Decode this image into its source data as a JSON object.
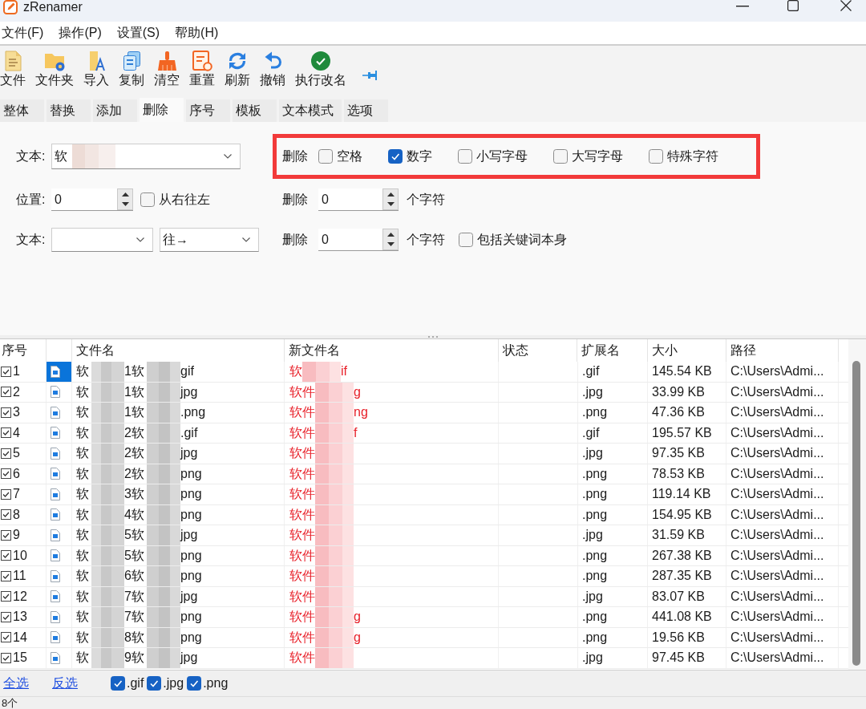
{
  "window": {
    "title": "zRenamer"
  },
  "menu": [
    {
      "label": "文件(F)"
    },
    {
      "label": "操作(P)"
    },
    {
      "label": "设置(S)"
    },
    {
      "label": "帮助(H)"
    }
  ],
  "toolbar": [
    {
      "label": "文件",
      "kind": "file"
    },
    {
      "label": "文件夹",
      "kind": "folder"
    },
    {
      "label": "导入",
      "kind": "import"
    },
    {
      "label": "复制",
      "kind": "copy"
    },
    {
      "label": "清空",
      "kind": "clear"
    },
    {
      "label": "重置",
      "kind": "reset"
    },
    {
      "label": "刷新",
      "kind": "refresh"
    },
    {
      "label": "撤销",
      "kind": "undo"
    },
    {
      "label": "执行改名",
      "kind": "run"
    }
  ],
  "tabs": [
    {
      "label": "整体",
      "selected": false
    },
    {
      "label": "替换",
      "selected": false
    },
    {
      "label": "添加",
      "selected": false
    },
    {
      "label": "删除",
      "selected": true
    },
    {
      "label": "序号",
      "selected": false
    },
    {
      "label": "模板",
      "selected": false
    },
    {
      "label": "文本模式",
      "selected": false
    },
    {
      "label": "选项",
      "selected": false
    }
  ],
  "delete_panel": {
    "text_field": {
      "label": "文本:",
      "value": "软"
    },
    "position": {
      "label": "位置:",
      "value": "0",
      "option": {
        "label": "从右往左",
        "checked": false
      }
    },
    "keyword": {
      "label": "文本:",
      "direction": "往→"
    },
    "delete_types": {
      "label": "删除",
      "highlighted": true,
      "options": [
        {
          "label": "空格",
          "checked": false
        },
        {
          "label": "数字",
          "checked": true
        },
        {
          "label": "小写字母",
          "checked": false
        },
        {
          "label": "大写字母",
          "checked": false
        },
        {
          "label": "特殊字符",
          "checked": false
        }
      ]
    },
    "delete_count": {
      "label": "删除",
      "value": "0",
      "unit": "个字符"
    },
    "delete_after_keyword": {
      "label": "删除",
      "value": "0",
      "unit": "个字符",
      "option": {
        "label": "包括关键词本身",
        "checked": false
      }
    }
  },
  "table": {
    "columns": [
      "序号",
      "文件名",
      "新文件名",
      "状态",
      "扩展名",
      "大小",
      "路径"
    ],
    "rows": [
      {
        "number": "1",
        "checked": true,
        "selected": true,
        "file_name": [
          "软",
          "1软",
          "gif"
        ],
        "new_name": [
          "软",
          "if"
        ],
        "extension": ".gif",
        "size": "145.54 KB",
        "path": "C:\\Users\\Admi..."
      },
      {
        "number": "2",
        "checked": true,
        "selected": false,
        "file_name": [
          "软",
          "1软",
          "jpg"
        ],
        "new_name": [
          "软件",
          "g"
        ],
        "extension": ".jpg",
        "size": "33.99 KB",
        "path": "C:\\Users\\Admi..."
      },
      {
        "number": "3",
        "checked": true,
        "selected": false,
        "file_name": [
          "软",
          "1软",
          ".png"
        ],
        "new_name": [
          "软件",
          "ng"
        ],
        "extension": ".png",
        "size": "47.36 KB",
        "path": "C:\\Users\\Admi..."
      },
      {
        "number": "4",
        "checked": true,
        "selected": false,
        "file_name": [
          "软",
          "2软",
          ".gif"
        ],
        "new_name": [
          "软件",
          "f"
        ],
        "extension": ".gif",
        "size": "195.57 KB",
        "path": "C:\\Users\\Admi..."
      },
      {
        "number": "5",
        "checked": true,
        "selected": false,
        "file_name": [
          "软",
          "2软",
          "jpg"
        ],
        "new_name": [
          "软件"
        ],
        "extension": ".jpg",
        "size": "97.35 KB",
        "path": "C:\\Users\\Admi..."
      },
      {
        "number": "6",
        "checked": true,
        "selected": false,
        "file_name": [
          "软",
          "2软",
          "png"
        ],
        "new_name": [
          "软件"
        ],
        "extension": ".png",
        "size": "78.53 KB",
        "path": "C:\\Users\\Admi..."
      },
      {
        "number": "7",
        "checked": true,
        "selected": false,
        "file_name": [
          "软",
          "3软",
          "png"
        ],
        "new_name": [
          "软件"
        ],
        "extension": ".png",
        "size": "119.14 KB",
        "path": "C:\\Users\\Admi..."
      },
      {
        "number": "8",
        "checked": true,
        "selected": false,
        "file_name": [
          "软",
          "4软",
          "png"
        ],
        "new_name": [
          "软件"
        ],
        "extension": ".png",
        "size": "154.95 KB",
        "path": "C:\\Users\\Admi..."
      },
      {
        "number": "9",
        "checked": true,
        "selected": false,
        "file_name": [
          "软",
          "5软",
          "jpg"
        ],
        "new_name": [
          "软件"
        ],
        "extension": ".jpg",
        "size": "31.59 KB",
        "path": "C:\\Users\\Admi..."
      },
      {
        "number": "10",
        "checked": true,
        "selected": false,
        "file_name": [
          "软",
          "5软",
          "png"
        ],
        "new_name": [
          "软件"
        ],
        "extension": ".png",
        "size": "267.38 KB",
        "path": "C:\\Users\\Admi..."
      },
      {
        "number": "11",
        "checked": true,
        "selected": false,
        "file_name": [
          "软",
          "6软",
          "png"
        ],
        "new_name": [
          "软件"
        ],
        "extension": ".png",
        "size": "287.35 KB",
        "path": "C:\\Users\\Admi..."
      },
      {
        "number": "12",
        "checked": true,
        "selected": false,
        "file_name": [
          "软",
          "7软",
          "jpg"
        ],
        "new_name": [
          "软件"
        ],
        "extension": ".jpg",
        "size": "83.07 KB",
        "path": "C:\\Users\\Admi..."
      },
      {
        "number": "13",
        "checked": true,
        "selected": false,
        "file_name": [
          "软",
          "7软",
          "png"
        ],
        "new_name": [
          "软件",
          "g"
        ],
        "extension": ".png",
        "size": "441.08 KB",
        "path": "C:\\Users\\Admi..."
      },
      {
        "number": "14",
        "checked": true,
        "selected": false,
        "file_name": [
          "软",
          "8软",
          "png"
        ],
        "new_name": [
          "软件",
          "g"
        ],
        "extension": ".png",
        "size": "19.56 KB",
        "path": "C:\\Users\\Admi..."
      },
      {
        "number": "15",
        "checked": true,
        "selected": false,
        "file_name": [
          "软",
          "9软",
          "jpg"
        ],
        "new_name": [
          "软件"
        ],
        "extension": ".jpg",
        "size": "97.45 KB",
        "path": "C:\\Users\\Admi..."
      }
    ]
  },
  "bottom_bar": {
    "links": [
      {
        "label": "全选"
      },
      {
        "label": "反选"
      }
    ],
    "filters": [
      {
        "label": ".gif",
        "checked": true
      },
      {
        "label": ".jpg",
        "checked": true
      },
      {
        "label": ".png",
        "checked": true
      }
    ]
  },
  "status_bar": {
    "text": "8个"
  }
}
